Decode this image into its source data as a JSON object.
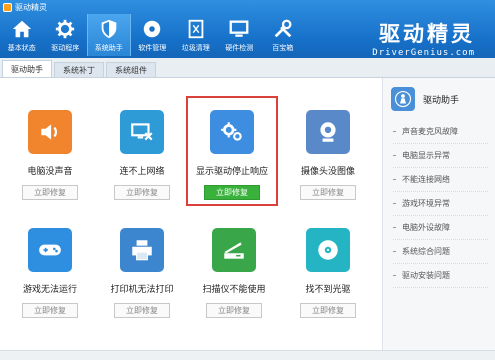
{
  "window": {
    "title": "驱动精灵"
  },
  "toolbar": {
    "items": [
      {
        "label": "基本状态",
        "icon": "home-icon"
      },
      {
        "label": "驱动程序",
        "icon": "gear-icon"
      },
      {
        "label": "系统助手",
        "icon": "shield-icon",
        "active": true
      },
      {
        "label": "软件管理",
        "icon": "disc-icon"
      },
      {
        "label": "垃圾清理",
        "icon": "trash-icon"
      },
      {
        "label": "硬件检测",
        "icon": "monitor-icon"
      },
      {
        "label": "百宝箱",
        "icon": "tools-icon"
      }
    ]
  },
  "brand": {
    "cn": "驱动精灵",
    "en": "DriverGenius.com"
  },
  "tabs": [
    {
      "label": "驱动助手",
      "active": true
    },
    {
      "label": "系统补丁"
    },
    {
      "label": "系统组件"
    }
  ],
  "cards": [
    {
      "label": "电脑没声音",
      "button": "立即修复",
      "icon": "speaker-icon",
      "color": "#f0852d"
    },
    {
      "label": "连不上网络",
      "button": "立即修复",
      "icon": "network-icon",
      "color": "#2e9bd6"
    },
    {
      "label": "显示驱动停止响应",
      "button": "立即修复",
      "icon": "display-gear-icon",
      "color": "#3d8de0",
      "selected": true
    },
    {
      "label": "摄像头没图像",
      "button": "立即修复",
      "icon": "webcam-icon",
      "color": "#5a89c9"
    },
    {
      "label": "游戏无法运行",
      "button": "立即修复",
      "icon": "gamepad-icon",
      "color": "#2e8fe0"
    },
    {
      "label": "打印机无法打印",
      "button": "立即修复",
      "icon": "printer-icon",
      "color": "#3b86cf"
    },
    {
      "label": "扫描仪不能使用",
      "button": "立即修复",
      "icon": "scanner-icon",
      "color": "#3aa64a"
    },
    {
      "label": "找不到光驱",
      "button": "立即修复",
      "icon": "cdrom-icon",
      "color": "#25b4c4"
    }
  ],
  "rightpanel": {
    "title": "驱动助手",
    "items": [
      "声音麦克风故障",
      "电脑显示异常",
      "不能连接网络",
      "游戏环境异常",
      "电脑外设故障",
      "系统综合问题",
      "驱动安装问题"
    ]
  },
  "colors": {
    "toolbar": "#1670c8",
    "primary_button": "#39b23b",
    "highlight": "#d9413a"
  }
}
